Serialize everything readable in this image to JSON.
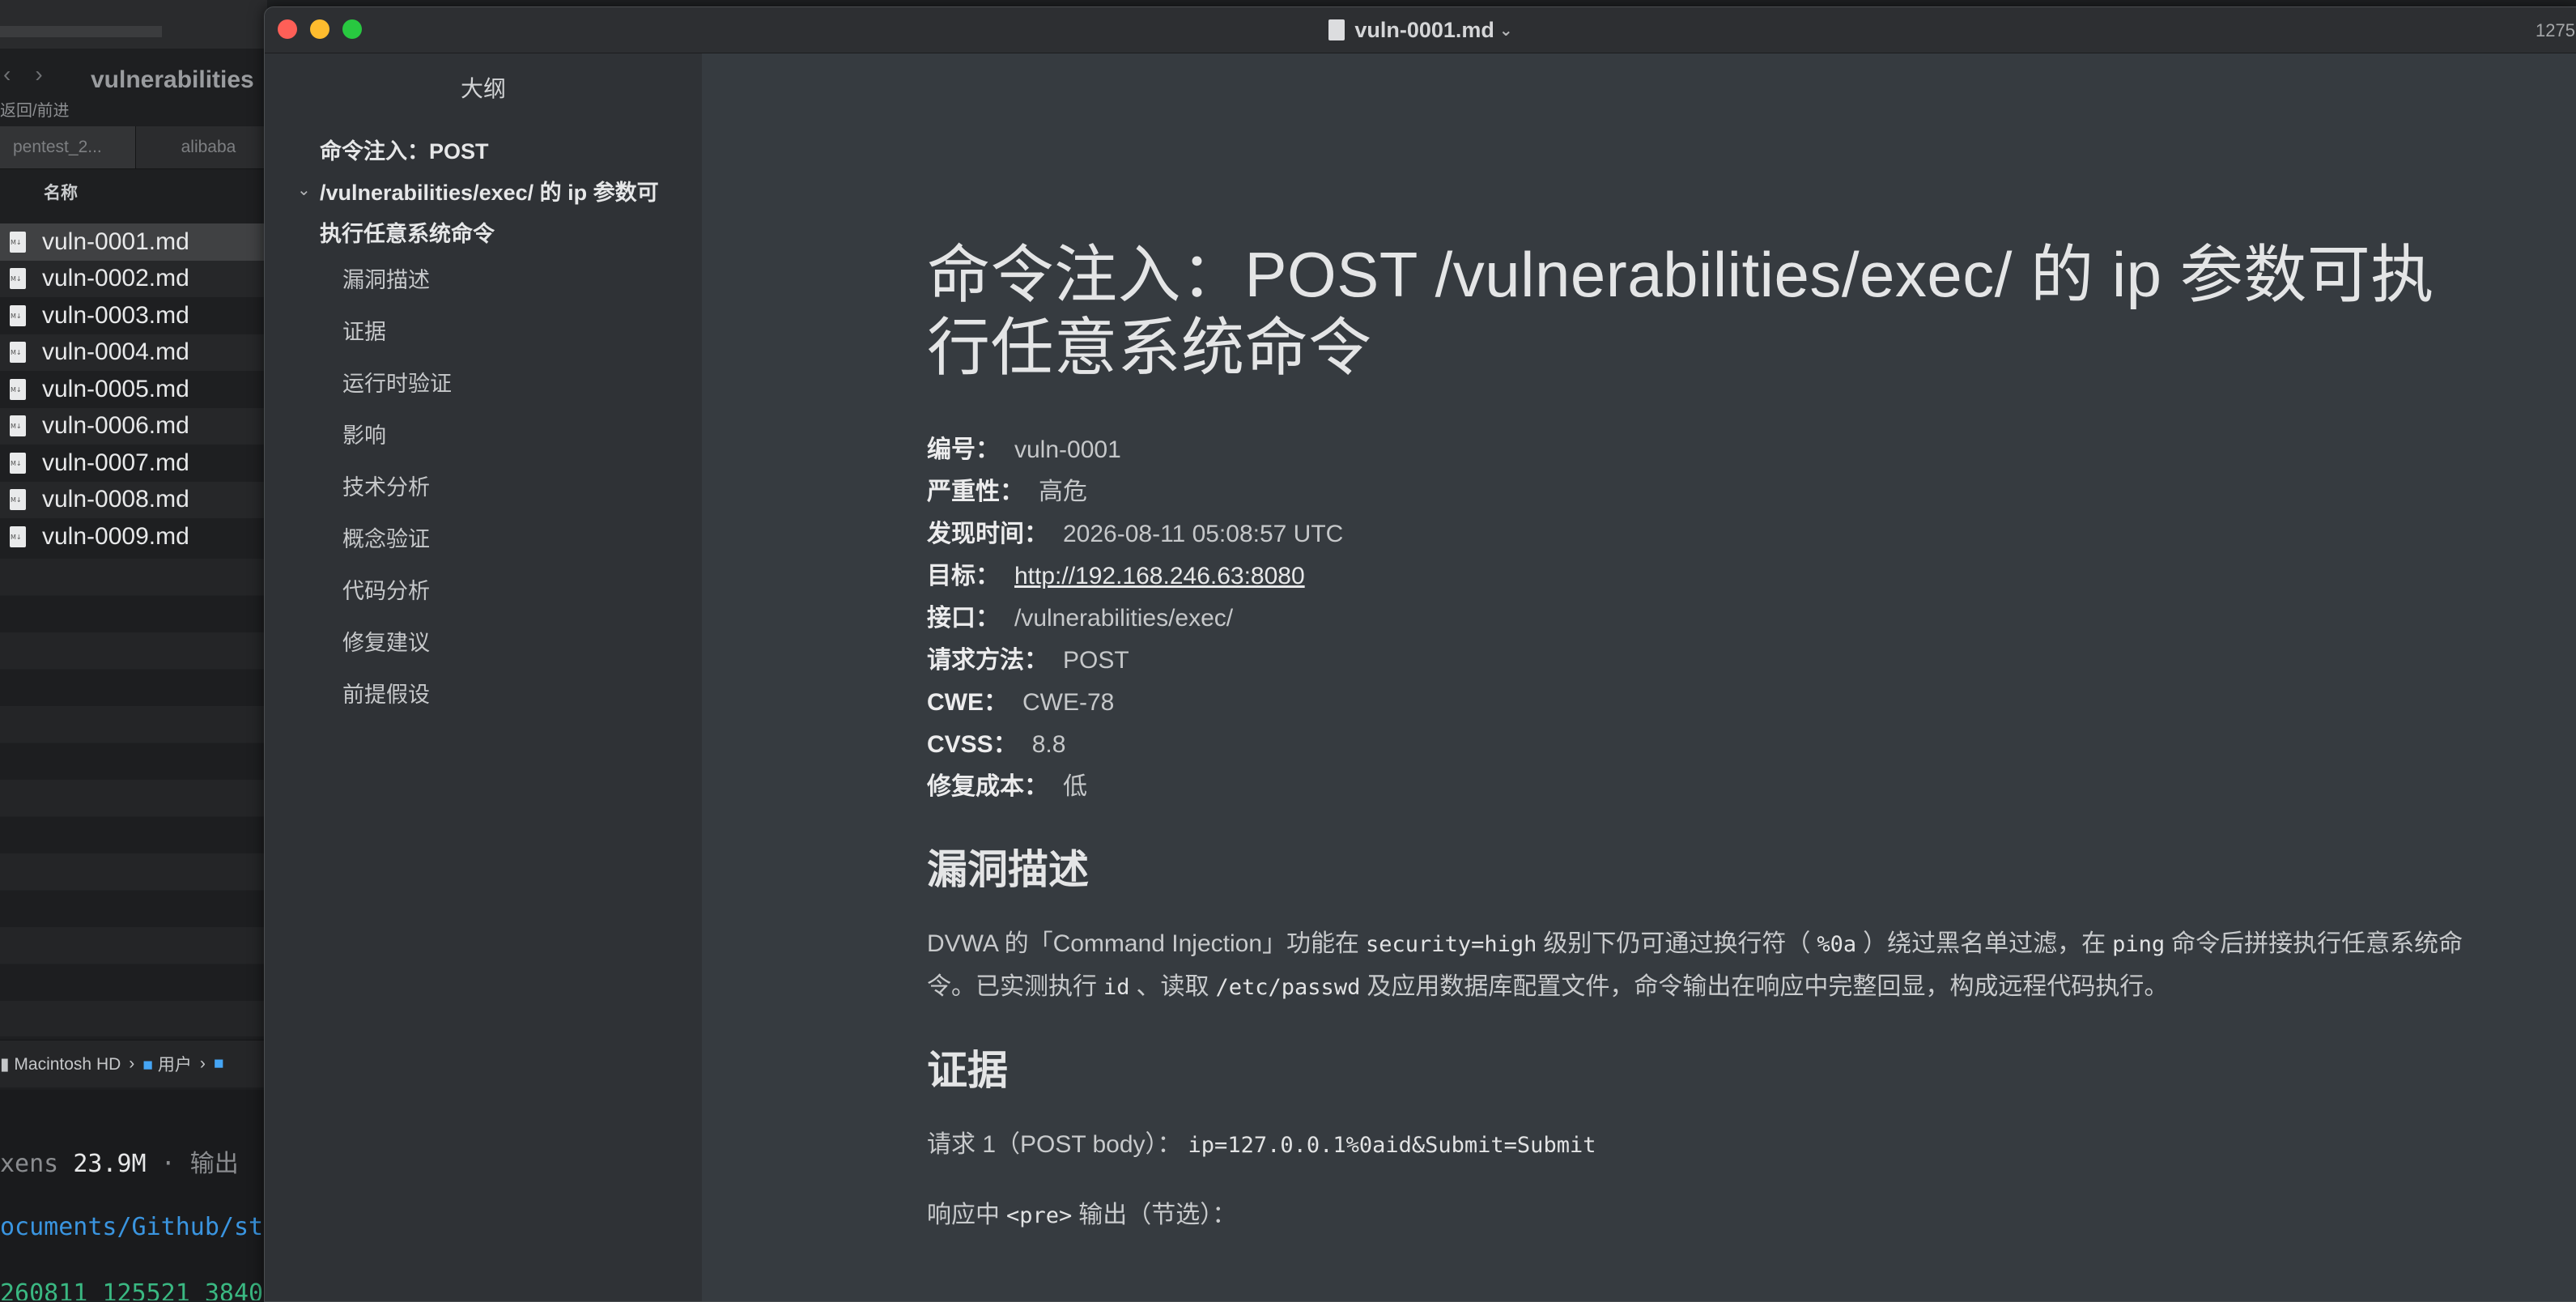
{
  "finder": {
    "nav_back": "‹",
    "nav_forward": "›",
    "title": "vulnerabilities",
    "nav_label": "返回/前进",
    "tabs": [
      "pentest_2...",
      "alibaba"
    ],
    "column_header": "名称",
    "files": [
      "vuln-0001.md",
      "vuln-0002.md",
      "vuln-0003.md",
      "vuln-0004.md",
      "vuln-0005.md",
      "vuln-0006.md",
      "vuln-0007.md",
      "vuln-0008.md",
      "vuln-0009.md"
    ],
    "selected_file": "vuln-0001.md",
    "path_bar": {
      "disk": "Macintosh HD",
      "sep": "›",
      "folder": "用户"
    }
  },
  "terminal": {
    "line1_prefix": "xens",
    "line1_value": "23.9M",
    "line1_suffix": "·  输出",
    "line2": "ocuments/Github/st",
    "line3": "260811_125521_3840"
  },
  "typora": {
    "doc_title": "vuln-0001.md",
    "word_count": "1275",
    "outline": {
      "title": "大纲",
      "main_heading": "命令注入：POST /vulnerabilities/exec/ 的 ip 参数可执行任意系统命令",
      "items": [
        "漏洞描述",
        "证据",
        "运行时验证",
        "影响",
        "技术分析",
        "概念验证",
        "代码分析",
        "修复建议",
        "前提假设"
      ]
    },
    "document": {
      "h1": "命令注入：POST /vulnerabilities/exec/ 的 ip 参数可执行任意系统命令",
      "meta": [
        {
          "label": "编号：",
          "value": "vuln-0001"
        },
        {
          "label": "严重性：",
          "value": "高危"
        },
        {
          "label": "发现时间：",
          "value": "2026-08-11 05:08:57 UTC"
        },
        {
          "label": "目标：",
          "value": "http://192.168.246.63:8080"
        },
        {
          "label": "接口：",
          "value": "/vulnerabilities/exec/"
        },
        {
          "label": "请求方法：",
          "value": "POST"
        },
        {
          "label": "CWE：",
          "value": "CWE-78"
        },
        {
          "label": "CVSS：",
          "value": "8.8"
        },
        {
          "label": "修复成本：",
          "value": "低"
        }
      ],
      "section1_title": "漏洞描述",
      "desc": {
        "p1": "DVWA 的「Command Injection」功能在",
        "c1": "security=high",
        "p2": "级别下仍可通过换行符（",
        "c2": "%0a",
        "p3": "）绕过黑名单过滤，在",
        "c3": "ping",
        "p4": "命令后拼接执行任意系统命令。已实测执行",
        "c4": "id",
        "p5": "、读取",
        "c5": "/etc/passwd",
        "p6": "及应用数据库配置文件，命令输出在响应中完整回显，构成远程代码执行。"
      },
      "section2_title": "证据",
      "evidence": {
        "req_label": "请求 1（POST body）：",
        "req_code": "ip=127.0.0.1%0aid&Submit=Submit",
        "resp_prefix": "响应中",
        "resp_code": "<pre>",
        "resp_suffix": "输出（节选）："
      }
    }
  }
}
